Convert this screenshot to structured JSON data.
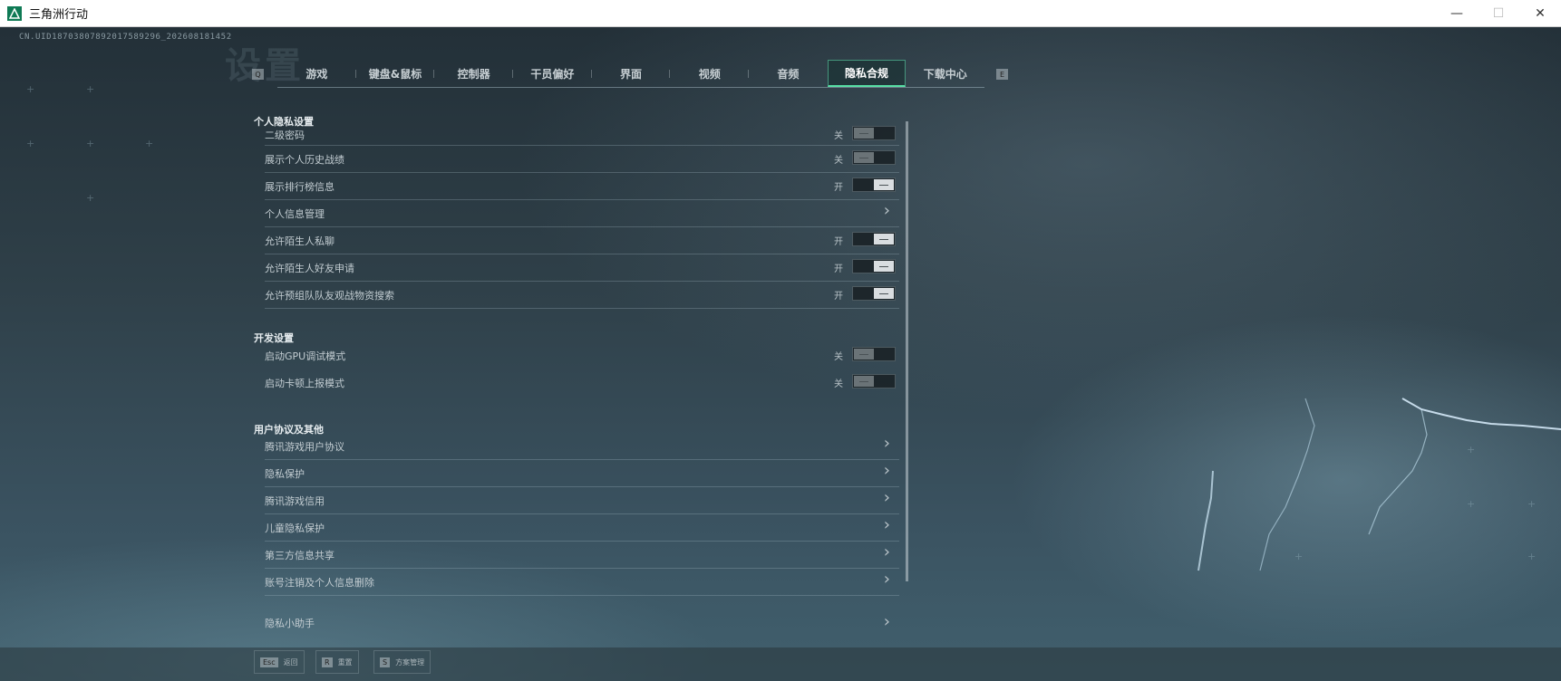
{
  "window": {
    "title": "三角洲行动",
    "logo_icon": "delta-logo-icon",
    "controls": {
      "minimize": "—",
      "restore": "☐",
      "close": "✕"
    }
  },
  "uid": "CN.UID18703807892017589296_202608181452",
  "tabs": {
    "prev_key": "Q",
    "next_key": "E",
    "items": [
      {
        "label": "游戏",
        "active": false
      },
      {
        "label": "键盘&鼠标",
        "active": false
      },
      {
        "label": "控制器",
        "active": false
      },
      {
        "label": "干员偏好",
        "active": false
      },
      {
        "label": "界面",
        "active": false
      },
      {
        "label": "视频",
        "active": false
      },
      {
        "label": "音频",
        "active": false
      },
      {
        "label": "隐私合规",
        "active": true
      },
      {
        "label": "下载中心",
        "active": false
      }
    ]
  },
  "sections": {
    "privacy": {
      "title": "个人隐私设置",
      "rows": [
        {
          "label": "二级密码",
          "state": "关",
          "type": "toggle",
          "on": false
        },
        {
          "label": "展示个人历史战绩",
          "state": "关",
          "type": "toggle",
          "on": false
        },
        {
          "label": "展示排行榜信息",
          "state": "开",
          "type": "toggle",
          "on": true
        },
        {
          "label": "个人信息管理",
          "type": "link"
        },
        {
          "label": "允许陌生人私聊",
          "state": "开",
          "type": "toggle",
          "on": true
        },
        {
          "label": "允许陌生人好友申请",
          "state": "开",
          "type": "toggle",
          "on": true
        },
        {
          "label": "允许预组队队友观战物资搜索",
          "state": "开",
          "type": "toggle",
          "on": true
        }
      ]
    },
    "dev": {
      "title": "开发设置",
      "rows": [
        {
          "label": "启动GPU调试模式",
          "state": "关",
          "type": "toggle",
          "on": false
        },
        {
          "label": "启动卡顿上报模式",
          "state": "关",
          "type": "toggle",
          "on": false
        }
      ]
    },
    "agreements": {
      "title": "用户协议及其他",
      "rows": [
        {
          "label": "腾讯游戏用户协议",
          "type": "link"
        },
        {
          "label": "隐私保护",
          "type": "link"
        },
        {
          "label": "腾讯游戏信用",
          "type": "link"
        },
        {
          "label": "儿童隐私保护",
          "type": "link"
        },
        {
          "label": "第三方信息共享",
          "type": "link"
        },
        {
          "label": "账号注销及个人信息删除",
          "type": "link"
        },
        {
          "label": "隐私小助手",
          "type": "link"
        }
      ]
    }
  },
  "footer": {
    "back": {
      "key": "Esc",
      "label": "返回"
    },
    "reset": {
      "key": "R",
      "label": "重置"
    },
    "scheme": {
      "key": "S",
      "label": "方案管理"
    }
  },
  "colors": {
    "accent": "#58e0a6",
    "brand": "#0f7a55"
  }
}
